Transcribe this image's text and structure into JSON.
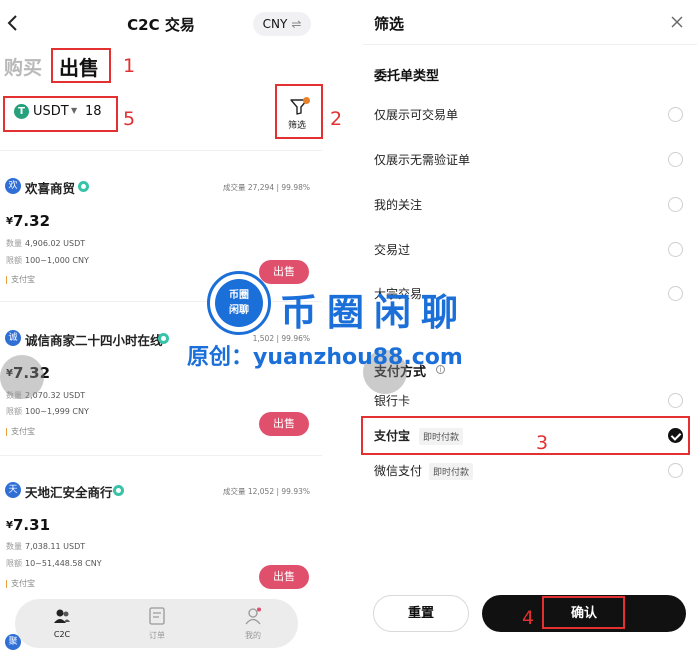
{
  "left": {
    "title": "C2C 交易",
    "currency_btn": "CNY",
    "currency_swap": "⇌",
    "tab_buy": "购买",
    "tab_sell": "出售",
    "coin": "USDT",
    "coin_icon_letter": "T",
    "amount": "18",
    "filter_label": "筛选",
    "merchants": [
      {
        "avatar": "欢",
        "name": "欢喜商贸",
        "stats": "成交量 27,294 | 99.98%",
        "currency": "¥",
        "price": "7.32",
        "qty_key": "数量",
        "qty": "4,906.02 USDT",
        "limit_key": "限额",
        "limit": "100~1,000 CNY",
        "pay": "支付宝",
        "action": "出售"
      },
      {
        "avatar": "诚",
        "name": "诚信商家二十四小时在线",
        "stats": "1,502 | 99.96%",
        "currency": "¥",
        "price": "7.32",
        "qty_key": "数量",
        "qty": "2,070.32 USDT",
        "limit_key": "限额",
        "limit": "100~1,999 CNY",
        "pay": "支付宝",
        "action": "出售"
      },
      {
        "avatar": "天",
        "name": "天地汇安全商行",
        "stats": "成交量 12,052 | 99.93%",
        "currency": "¥",
        "price": "7.31",
        "qty_key": "数量",
        "qty": "7,038.11 USDT",
        "limit_key": "限额",
        "limit": "10~51,448.58 CNY",
        "pay": "支付宝",
        "action": "出售"
      }
    ],
    "peek_avatar": "聚",
    "nav": [
      {
        "label": "C2C",
        "icon": "user-group-icon"
      },
      {
        "label": "订单",
        "icon": "document-icon"
      },
      {
        "label": "我的",
        "icon": "profile-icon"
      }
    ]
  },
  "right": {
    "title": "筛选",
    "section_order_type": "委托单类型",
    "options": [
      "仅展示可交易单",
      "仅展示无需验证单",
      "我的关注",
      "交易过",
      "大宗交易"
    ],
    "section_payment": "支付方式",
    "payments": [
      {
        "label": "银行卡",
        "tag": "",
        "selected": false
      },
      {
        "label": "支付宝",
        "tag": "即时付款",
        "selected": true
      },
      {
        "label": "微信支付",
        "tag": "即时付款",
        "selected": false
      }
    ],
    "reset": "重置",
    "confirm": "确认"
  },
  "annotations": [
    "1",
    "2",
    "3",
    "4",
    "5"
  ],
  "watermark": {
    "badge_line1": "币圈",
    "badge_line2": "闲聊",
    "big": "币圈闲聊",
    "site": "原创：yuanzhou88.com"
  },
  "colors": {
    "annotation_red": "#e33131",
    "sell_button": "#e0506c",
    "usdt_green": "#26a17b",
    "watermark_blue": "#1b6fd8",
    "verified_badge": "#39c2a8"
  }
}
